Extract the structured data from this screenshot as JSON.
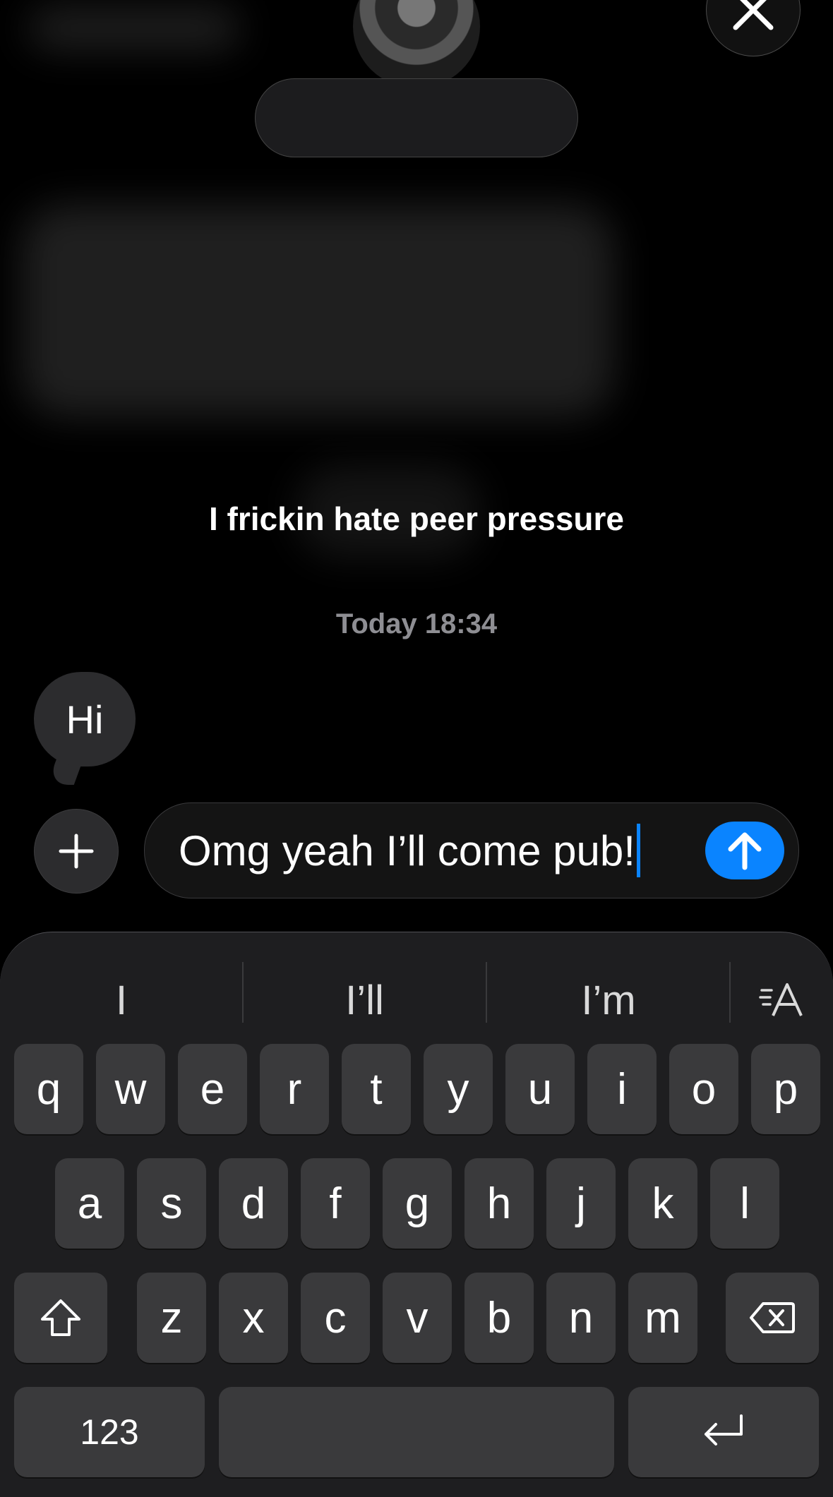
{
  "header": {
    "close_icon": "close-icon",
    "avatar": "contact-photo"
  },
  "conversation": {
    "status_text": "I frickin hate peer pressure",
    "timestamp": "Today 18:34",
    "incoming_message": "Hi"
  },
  "composer": {
    "text": "Omg yeah I’ll come pub!",
    "plus_icon": "plus-icon",
    "send_icon": "arrow-up-icon",
    "accent": "#0a84ff"
  },
  "keyboard": {
    "predictions": [
      "I",
      "I’ll",
      "I’m"
    ],
    "text_format_icon": "text-format-icon",
    "row1": [
      "q",
      "w",
      "e",
      "r",
      "t",
      "y",
      "u",
      "i",
      "o",
      "p"
    ],
    "row2": [
      "a",
      "s",
      "d",
      "f",
      "g",
      "h",
      "j",
      "k",
      "l"
    ],
    "row3": [
      "z",
      "x",
      "c",
      "v",
      "b",
      "n",
      "m"
    ],
    "numbers_label": "123",
    "shift_icon": "shift-icon",
    "delete_icon": "delete-icon",
    "return_icon": "return-icon"
  }
}
